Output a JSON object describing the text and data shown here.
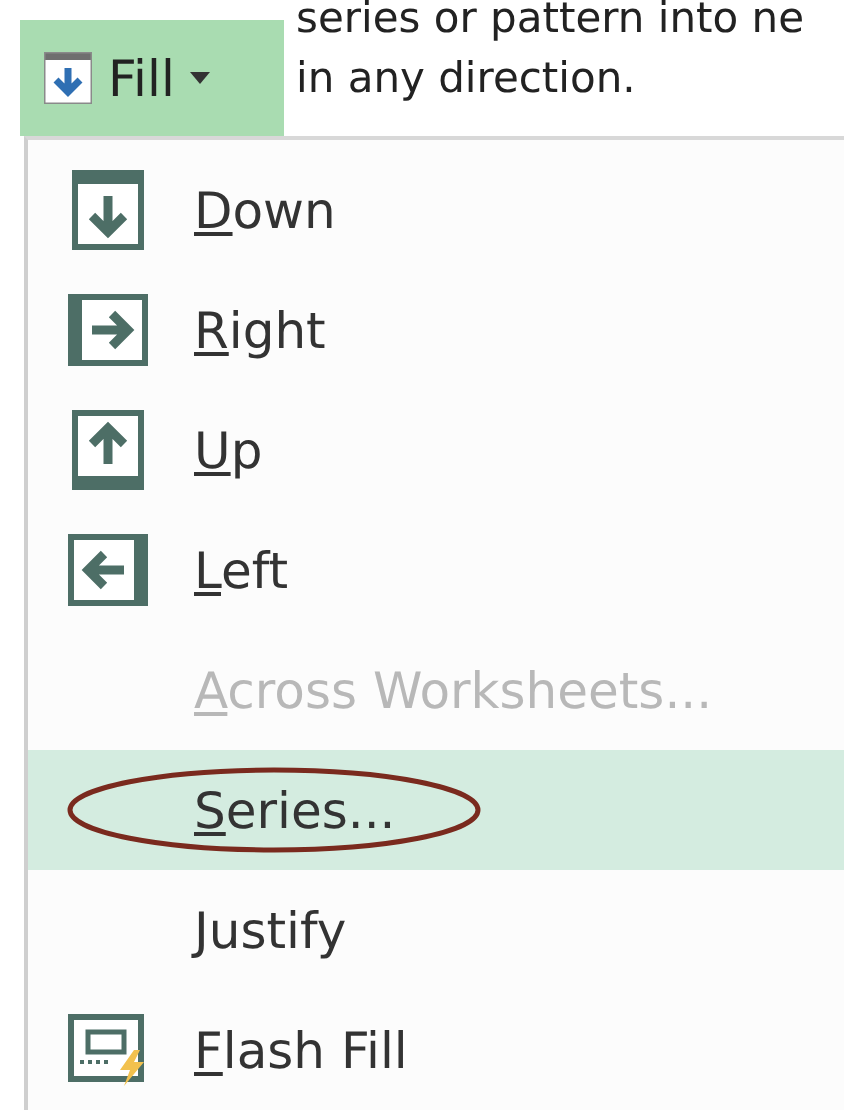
{
  "description": {
    "lines": [
      "series or pattern into ne",
      "in any direction."
    ]
  },
  "fill_button": {
    "label": "Fill"
  },
  "menu": {
    "items": [
      {
        "label": "Down",
        "kind": "down",
        "disabled": false,
        "selected": false,
        "circled": false
      },
      {
        "label": "Right",
        "kind": "right",
        "disabled": false,
        "selected": false,
        "circled": false
      },
      {
        "label": "Up",
        "kind": "up",
        "disabled": false,
        "selected": false,
        "circled": false
      },
      {
        "label": "Left",
        "kind": "left",
        "disabled": false,
        "selected": false,
        "circled": false
      },
      {
        "label": "Across Worksheets...",
        "kind": "plain",
        "disabled": true,
        "selected": false,
        "circled": false
      },
      {
        "label": "Series...",
        "kind": "plain",
        "disabled": false,
        "selected": true,
        "circled": true
      },
      {
        "label": "Justify",
        "kind": "plain",
        "disabled": false,
        "selected": false,
        "circled": false
      },
      {
        "label": "Flash Fill",
        "kind": "flash",
        "disabled": false,
        "selected": false,
        "circled": false
      }
    ]
  }
}
